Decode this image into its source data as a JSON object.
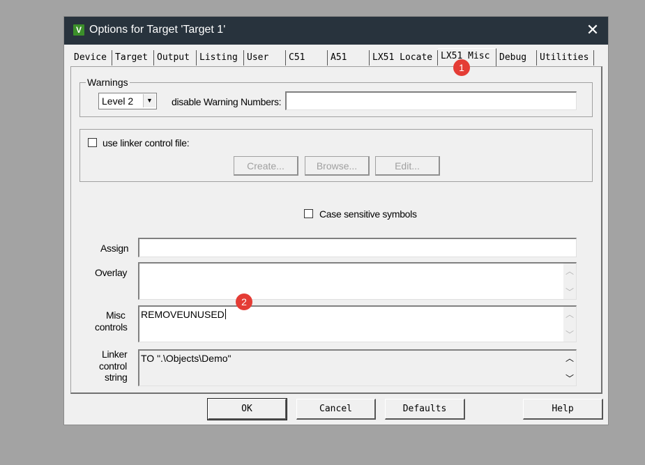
{
  "window": {
    "icon": "keil-uvision-icon",
    "title": "Options for Target 'Target 1'",
    "close_glyph": "✕"
  },
  "tabs": [
    {
      "label": "Device"
    },
    {
      "label": "Target"
    },
    {
      "label": "Output"
    },
    {
      "label": "Listing"
    },
    {
      "label": "User"
    },
    {
      "label": "C51"
    },
    {
      "label": "A51"
    },
    {
      "label": "LX51 Locate"
    },
    {
      "label": "LX51 Misc",
      "active": true
    },
    {
      "label": "Debug"
    },
    {
      "label": "Utilities"
    }
  ],
  "warnings": {
    "legend": "Warnings",
    "level_value": "Level 2",
    "disable_label": "disable Warning Numbers:",
    "disable_value": ""
  },
  "linker_control_file": {
    "label": "use linker control file:",
    "checked": false,
    "create_label": "Create...",
    "browse_label": "Browse...",
    "edit_label": "Edit..."
  },
  "case_sensitive": {
    "label": "Case sensitive symbols",
    "checked": false
  },
  "fields": {
    "assign_label": "Assign",
    "assign_value": "",
    "overlay_label": "Overlay",
    "overlay_value": "",
    "misc_label_line1": "Misc",
    "misc_label_line2": "controls",
    "misc_value": "REMOVEUNUSED",
    "linker_label_line1": "Linker",
    "linker_label_line2": "control",
    "linker_label_line3": "string",
    "linker_value": "TO \".\\Objects\\Demo\""
  },
  "buttons": {
    "ok": "OK",
    "cancel": "Cancel",
    "defaults": "Defaults",
    "help": "Help"
  },
  "annotations": {
    "badge1": "1",
    "badge2": "2",
    "color": "#e43c35"
  }
}
